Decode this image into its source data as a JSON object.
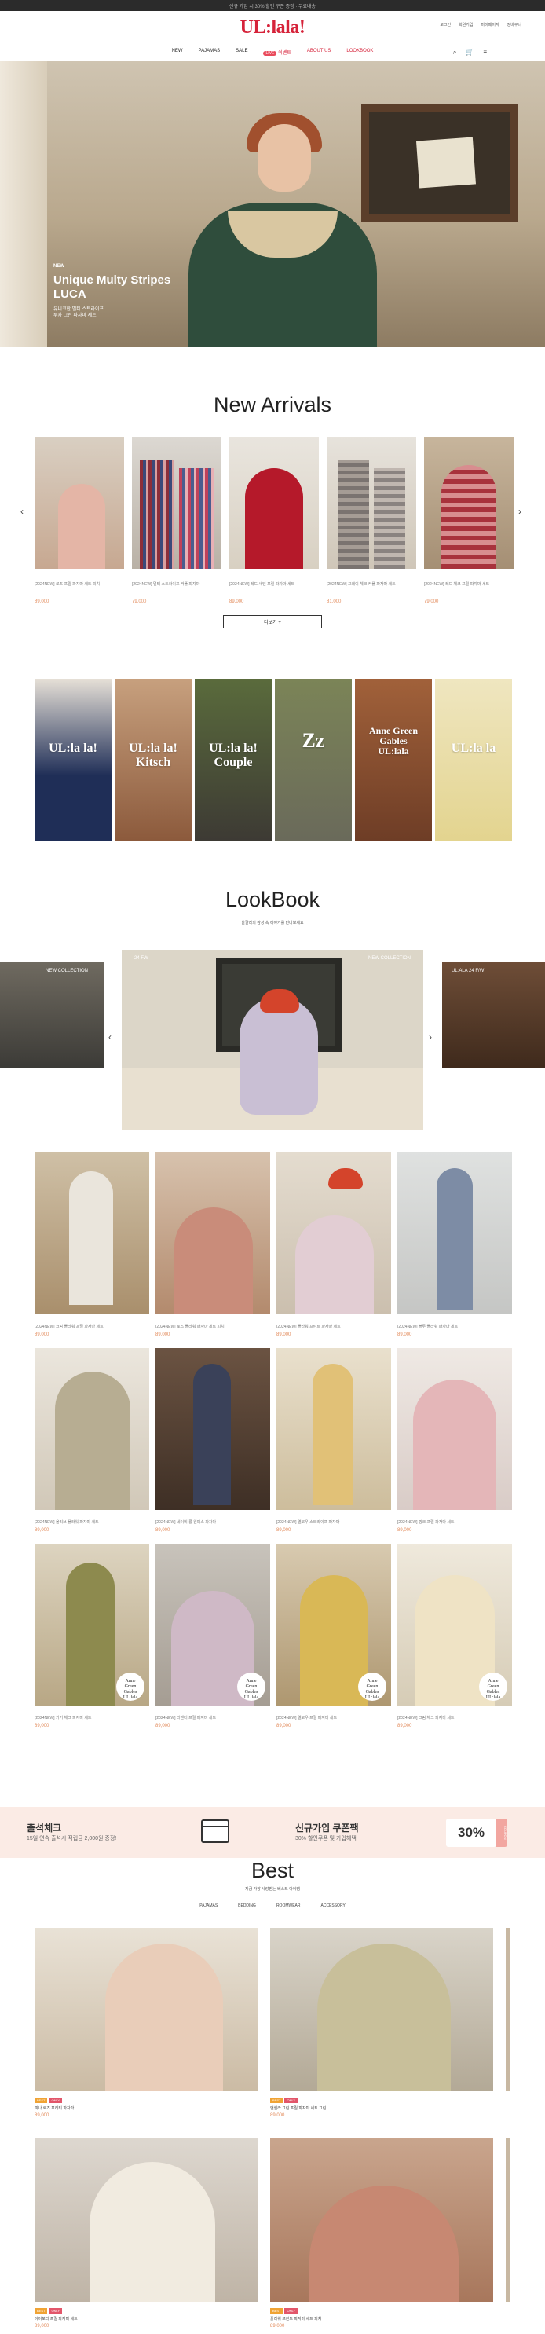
{
  "topbar": {
    "text": "신규 가입 시 30% 할인 쿠폰 증정 · 무료배송"
  },
  "header": {
    "logo": "UL:lala!",
    "util": [
      "로그인",
      "회원가입",
      "마이페이지",
      "장바구니"
    ],
    "nav": [
      {
        "label": "NEW"
      },
      {
        "label": "PAJAMAS"
      },
      {
        "label": "SALE"
      },
      {
        "label": "이벤트",
        "live": "LIVE"
      },
      {
        "label": "ABOUT US"
      },
      {
        "label": "LOOKBOOK"
      }
    ],
    "icons": [
      "search-icon",
      "cart-icon",
      "menu-icon"
    ]
  },
  "hero": {
    "tag": "NEW",
    "title_line1": "Unique Multy Stripes",
    "title_line2": "LUCA",
    "sub_line1": "유니크한 멀티 스트라이프",
    "sub_line2": "루카 그린 파자마 세트"
  },
  "new_arrivals": {
    "title": "New Arrivals",
    "more_label": "더보기 +",
    "products": [
      {
        "name": "[2024NEW] 로즈 프릴 파자마 세트 피치",
        "price": "89,000"
      },
      {
        "name": "[2024NEW] 멀티 스트라이프 커플 파자마",
        "price": "79,000"
      },
      {
        "name": "[2024NEW] 레드 새틴 프릴 파자마 세트",
        "price": "89,000"
      },
      {
        "name": "[2024NEW] 그레이 체크 커플 파자마 세트",
        "price": "81,000"
      },
      {
        "name": "[2024NEW] 레드 체크 프릴 파자마 세트",
        "price": "79,000"
      }
    ]
  },
  "collections": [
    {
      "label": "UL:la la!",
      "label2": ""
    },
    {
      "label": "UL:la la!",
      "label2": "Kitsch"
    },
    {
      "label": "UL:la la!",
      "label2": "Couple"
    },
    {
      "label": "Zz",
      "label2": ""
    },
    {
      "label": "Anne Green Gables",
      "label2": "UL:lala"
    },
    {
      "label": "UL:la la",
      "label2": ""
    }
  ],
  "lookbook": {
    "title": "LookBook",
    "subtitle": "울랄라의 감성 속 이야기를 만나보세요",
    "slides": [
      {
        "label": "NEW COLLECTION"
      },
      {
        "label": "NEW COLLECTION",
        "badge": "24 FW"
      },
      {
        "label": "UL:ALA 24 F/W"
      }
    ]
  },
  "lookbook_grid": [
    {
      "name": "[2024NEW] 크림 플라워 프릴 파자마 세트",
      "price": "89,000"
    },
    {
      "name": "[2024NEW] 로즈 플라워 파자마 세트 피치",
      "price": "89,000"
    },
    {
      "name": "[2024NEW] 플라워 프린트 파자마 세트",
      "price": "89,000"
    },
    {
      "name": "[2024NEW] 블루 플라워 파자마 세트",
      "price": "89,000"
    },
    {
      "name": "[2024NEW] 올리브 플라워 파자마 세트",
      "price": "89,000"
    },
    {
      "name": "[2024NEW] 네이비 롱 원피스 파자마",
      "price": "89,000"
    },
    {
      "name": "[2024NEW] 옐로우 스트라이프 파자마",
      "price": "89,000"
    },
    {
      "name": "[2024NEW] 핑크 프릴 파자마 세트",
      "price": "89,000"
    },
    {
      "name": "[2024NEW] 카키 체크 파자마 세트",
      "price": "89,000"
    },
    {
      "name": "[2024NEW] 라벤더 프릴 파자마 세트",
      "price": "89,000"
    },
    {
      "name": "[2024NEW] 옐로우 프릴 파자마 세트",
      "price": "89,000"
    },
    {
      "name": "[2024NEW] 크림 체크 파자마 세트",
      "price": "89,000"
    }
  ],
  "badge_text": {
    "line1": "Anne",
    "line2": "Green",
    "line3": "Gables",
    "line4": "UL:lala"
  },
  "banner": {
    "left_title": "출석체크",
    "left_sub": "15일 연속 출석시 적립금 2,000원 증정!",
    "right_title": "신규가입 쿠폰팩",
    "right_sub": "30% 할인쿠폰 및 가입혜택",
    "coupon": "30%",
    "coupon_tab": "COUPON"
  },
  "best": {
    "title": "Best",
    "subtitle": "지금 가장 사랑받는 베스트 아이템",
    "tabs": [
      "PAJAMAS",
      "BEDDING",
      "ROOMWEAR",
      "ACCESSORY"
    ],
    "items": [
      {
        "tags": [
          "BEST",
          "ONLY"
        ],
        "name": "피나 로즈 프리티 파자마",
        "price": "89,000"
      },
      {
        "tags": [
          "BEST",
          "ONLY"
        ],
        "name": "앤셀라 그린 프릴 파자마 세트 그린",
        "price": "89,000"
      },
      {
        "tags": [
          "BEST",
          "ONLY"
        ],
        "name": "아이보리 프릴 파자마 세트",
        "price": "89,000"
      },
      {
        "tags": [
          "BEST",
          "ONLY"
        ],
        "name": "플라워 프린트 파자마 세트 피치",
        "price": "89,000"
      }
    ]
  }
}
